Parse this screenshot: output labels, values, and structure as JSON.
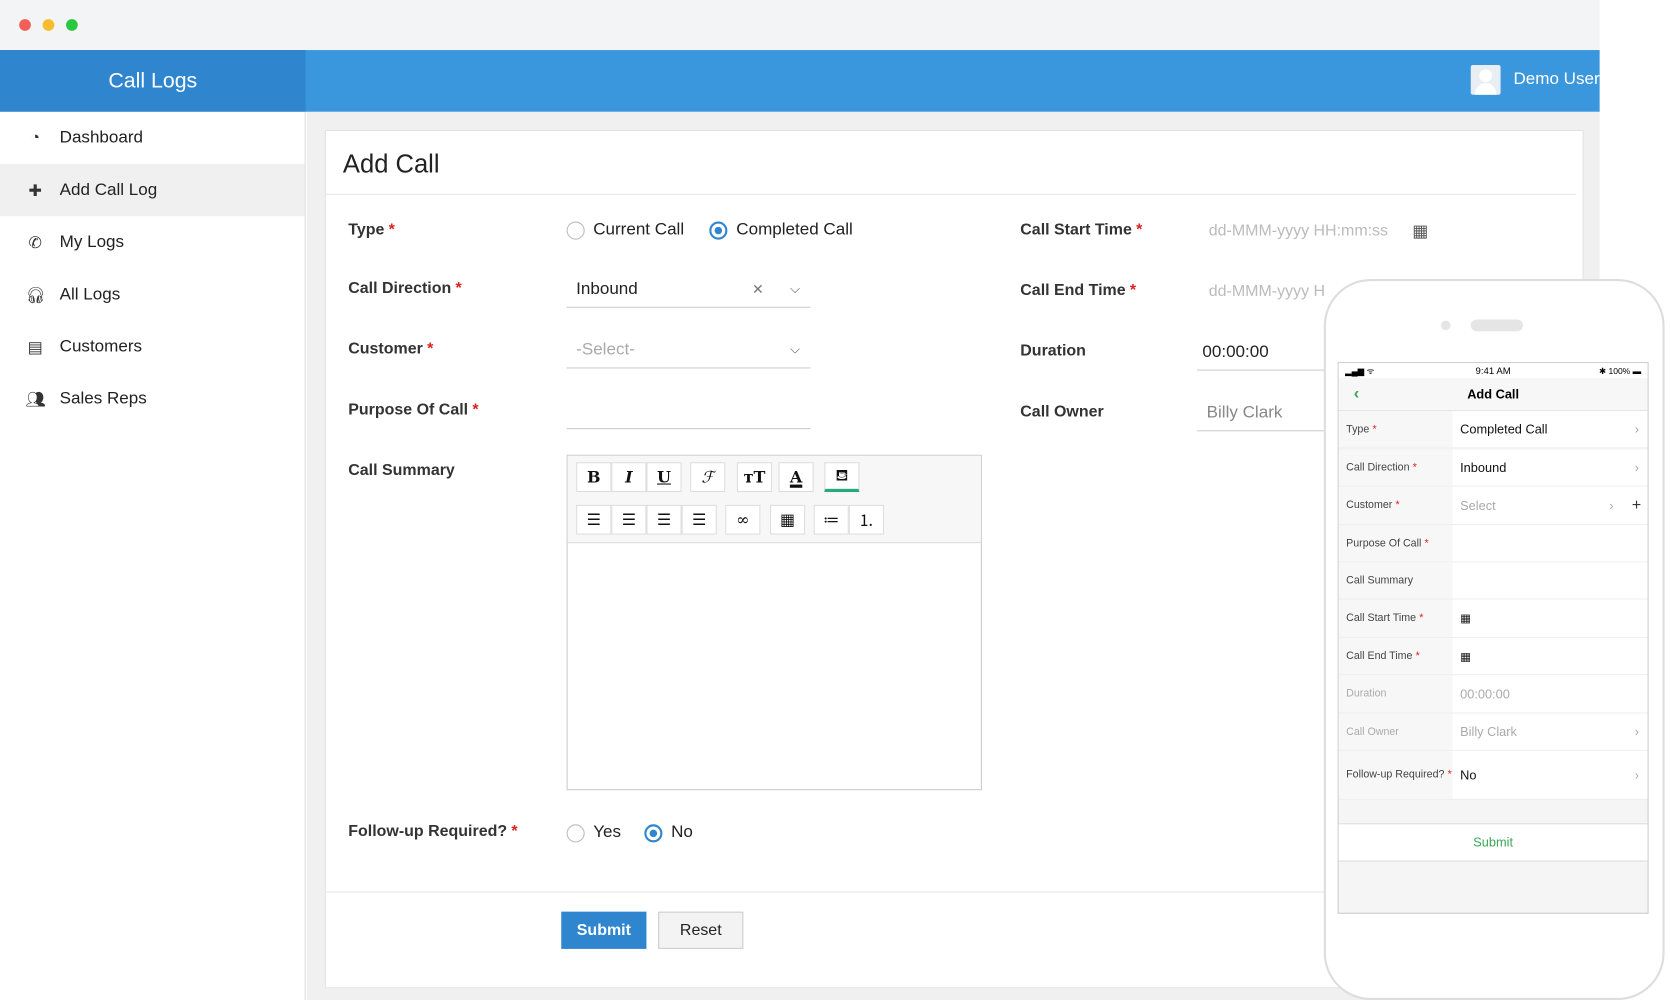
{
  "app": {
    "title": "Call Logs",
    "user": "Demo User"
  },
  "sidebar": {
    "items": [
      {
        "label": "Dashboard",
        "icon": "dashboard-icon",
        "glyph": "◔"
      },
      {
        "label": "Add Call Log",
        "icon": "plus-icon",
        "glyph": "✚"
      },
      {
        "label": "My Logs",
        "icon": "phone-icon",
        "glyph": "✆"
      },
      {
        "label": "All Logs",
        "icon": "headset-icon",
        "glyph": "🎧︎"
      },
      {
        "label": "Customers",
        "icon": "contacts-icon",
        "glyph": "▤"
      },
      {
        "label": "Sales Reps",
        "icon": "group-icon",
        "glyph": "👥︎"
      }
    ]
  },
  "form": {
    "title": "Add Call",
    "type_label": "Type",
    "type_options": [
      "Current Call",
      "Completed Call"
    ],
    "direction_label": "Call Direction",
    "direction_value": "Inbound",
    "customer_label": "Customer",
    "customer_placeholder": "-Select-",
    "purpose_label": "Purpose Of Call",
    "summary_label": "Call Summary",
    "followup_label": "Follow-up Required?",
    "followup_options": [
      "Yes",
      "No"
    ],
    "start_label": "Call Start Time",
    "start_placeholder": "dd-MMM-yyyy HH:mm:ss",
    "end_label": "Call End Time",
    "end_placeholder": "dd-MMM-yyyy HH:mm:ss",
    "duration_label": "Duration",
    "duration_value": "00:00:00",
    "owner_label": "Call Owner",
    "owner_value": "Billy Clark",
    "submit": "Submit",
    "reset": "Reset",
    "req": "*"
  },
  "phone": {
    "time": "9:41 AM",
    "battery": "100%",
    "title": "Add Call",
    "submit": "Submit",
    "rows": [
      {
        "label": "Type",
        "value": "Completed Call"
      },
      {
        "label": "Call Direction",
        "value": "Inbound"
      },
      {
        "label": "Customer",
        "value": "Select"
      },
      {
        "label": "Purpose Of Call",
        "value": ""
      },
      {
        "label": "Call Summary",
        "value": ""
      },
      {
        "label": "Call Start Time",
        "value": ""
      },
      {
        "label": "Call End Time",
        "value": ""
      },
      {
        "label": "Duration",
        "value": "00:00:00"
      },
      {
        "label": "Call Owner",
        "value": "Billy Clark"
      },
      {
        "label": "Follow-up Required?",
        "value": "No"
      }
    ]
  }
}
